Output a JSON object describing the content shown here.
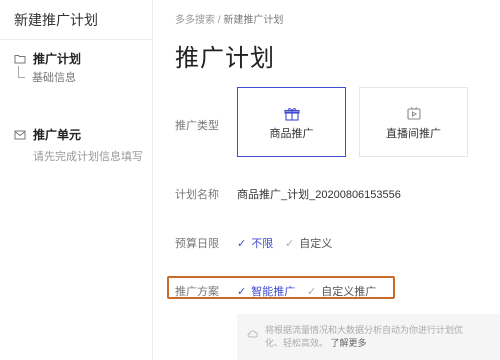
{
  "sidebar": {
    "title": "新建推广计划",
    "plan": {
      "label": "推广计划",
      "sub_item": "基础信息"
    },
    "unit": {
      "label": "推广单元",
      "desc": "请先完成计划信息填写"
    }
  },
  "breadcrumb": {
    "root": "多多搜索",
    "sep": "/",
    "current": "新建推广计划"
  },
  "page_title": "推广计划",
  "form": {
    "type": {
      "label": "推广类型",
      "options": [
        {
          "label": "商品推广",
          "icon": "gift-icon",
          "selected": true
        },
        {
          "label": "直播间推广",
          "icon": "live-tv-icon",
          "selected": false
        }
      ]
    },
    "name": {
      "label": "计划名称",
      "value": "商品推广_计划_20200806153556"
    },
    "budget": {
      "label": "预算日限",
      "options": [
        {
          "label": "不限",
          "selected": true
        },
        {
          "label": "自定义",
          "selected": false
        }
      ]
    },
    "scheme": {
      "label": "推广方案",
      "options": [
        {
          "label": "智能推广",
          "selected": true
        },
        {
          "label": "自定义推广",
          "selected": false
        }
      ]
    },
    "info": {
      "text": "将根据流量情况和大数据分析自动为你进行计划优化、轻松高效。",
      "more": "了解更多"
    }
  },
  "colors": {
    "accent": "#3f4bd0",
    "highlight": "#c96a2b",
    "border": "#ececec"
  }
}
